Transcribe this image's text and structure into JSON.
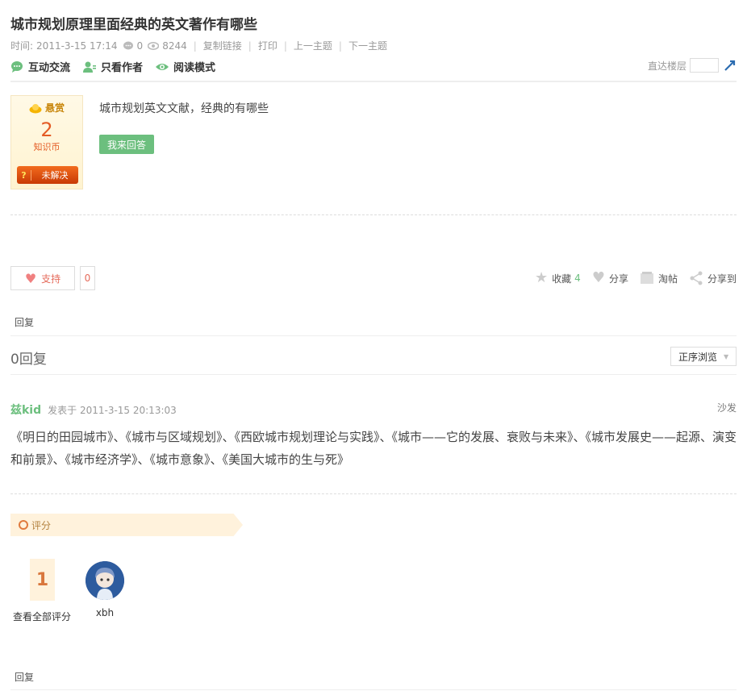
{
  "thread": {
    "title": "城市规划原理里面经典的英文著作有哪些",
    "meta": {
      "time_label": "时间:",
      "time_value": "2011-3-15 17:14",
      "replies": "0",
      "views": "8244",
      "copy_link": "复制链接",
      "print": "打印",
      "prev": "上一主题",
      "next": "下一主题"
    },
    "toolbar": {
      "interact": "互动交流",
      "author_only": "只看作者",
      "read_mode": "阅读模式",
      "jump_label": "直达楼层"
    }
  },
  "reward": {
    "label": "悬赏",
    "amount": "2",
    "unit": "知识币",
    "status_icon": "?",
    "status": "未解决"
  },
  "question": {
    "text": "城市规划英文文献，经典的有哪些",
    "answer_button": "我来回答"
  },
  "actions": {
    "support_label": "支持",
    "support_count": "0",
    "favorite_label": "收藏",
    "favorite_count": "4",
    "share_label": "分享",
    "tao_label": "淘帖",
    "share_to_label": "分享到"
  },
  "reply_link": "回复",
  "replies_header": {
    "count_text": "0回复",
    "sort_label": "正序浏览"
  },
  "post": {
    "author": "兹kid",
    "posted": "发表于 2011-3-15 20:13:03",
    "floor": "沙发",
    "body": "《明日的田园城市》、《城市与区域规划》、《西欧城市规划理论与实践》、《城市——它的发展、衰败与未来》、《城市发展史——起源、演变和前景》、《城市经济学》、《城市意象》、《美国大城市的生与死》"
  },
  "rating": {
    "label": "评分",
    "score": "1",
    "view_all": "查看全部评分",
    "rater_name": "xbh"
  },
  "icons": {
    "chat": "chat-icon",
    "person": "person-icon",
    "eye": "eye-icon",
    "star": "star-icon",
    "heart": "heart-icon",
    "share": "share-icon"
  }
}
